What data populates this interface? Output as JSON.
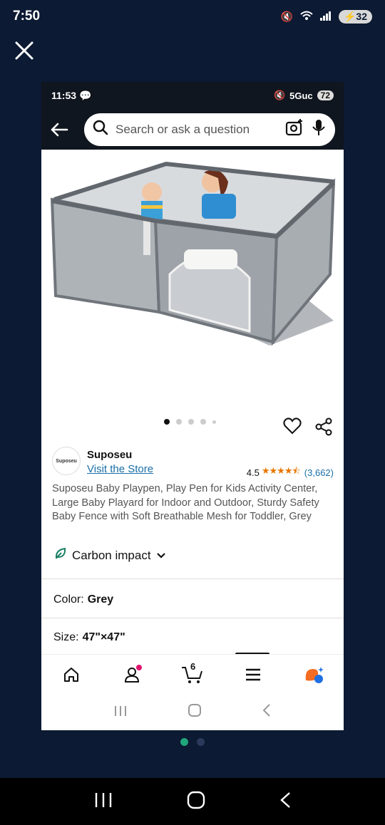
{
  "outer_status": {
    "time": "7:50",
    "battery": "32"
  },
  "inner_status": {
    "time": "11:53",
    "network": "5Guc",
    "battery": "72"
  },
  "search": {
    "placeholder": "Search or ask a question"
  },
  "product": {
    "brand": "Suposeu",
    "brand_logo_text": "Suposeu",
    "visit_store": "Visit the Store",
    "rating": "4.5",
    "stars": "★★★★⯪",
    "review_count": "(3,662)",
    "title": "Suposeu Baby Playpen, Play Pen for Kids Activity Center, Large Baby Playard for Indoor and Outdoor, Sturdy Safety Baby Fence with Soft Breathable Mesh for Toddler, Grey",
    "carbon_label": "Carbon impact",
    "image_count": 5,
    "active_image": 1
  },
  "options": {
    "color_label": "Color:",
    "color_value": "Grey",
    "size_label": "Size:",
    "size_value": "47\"×47\""
  },
  "bottom_nav": {
    "items": [
      "home-icon",
      "account-icon",
      "cart-icon",
      "menu-icon",
      "rufus-icon"
    ],
    "cart_count": "6"
  },
  "colors": {
    "accent_link": "#1a6fa8",
    "star": "#e77600",
    "header_bg": "#10161f",
    "page_bg": "#0c1a33"
  }
}
